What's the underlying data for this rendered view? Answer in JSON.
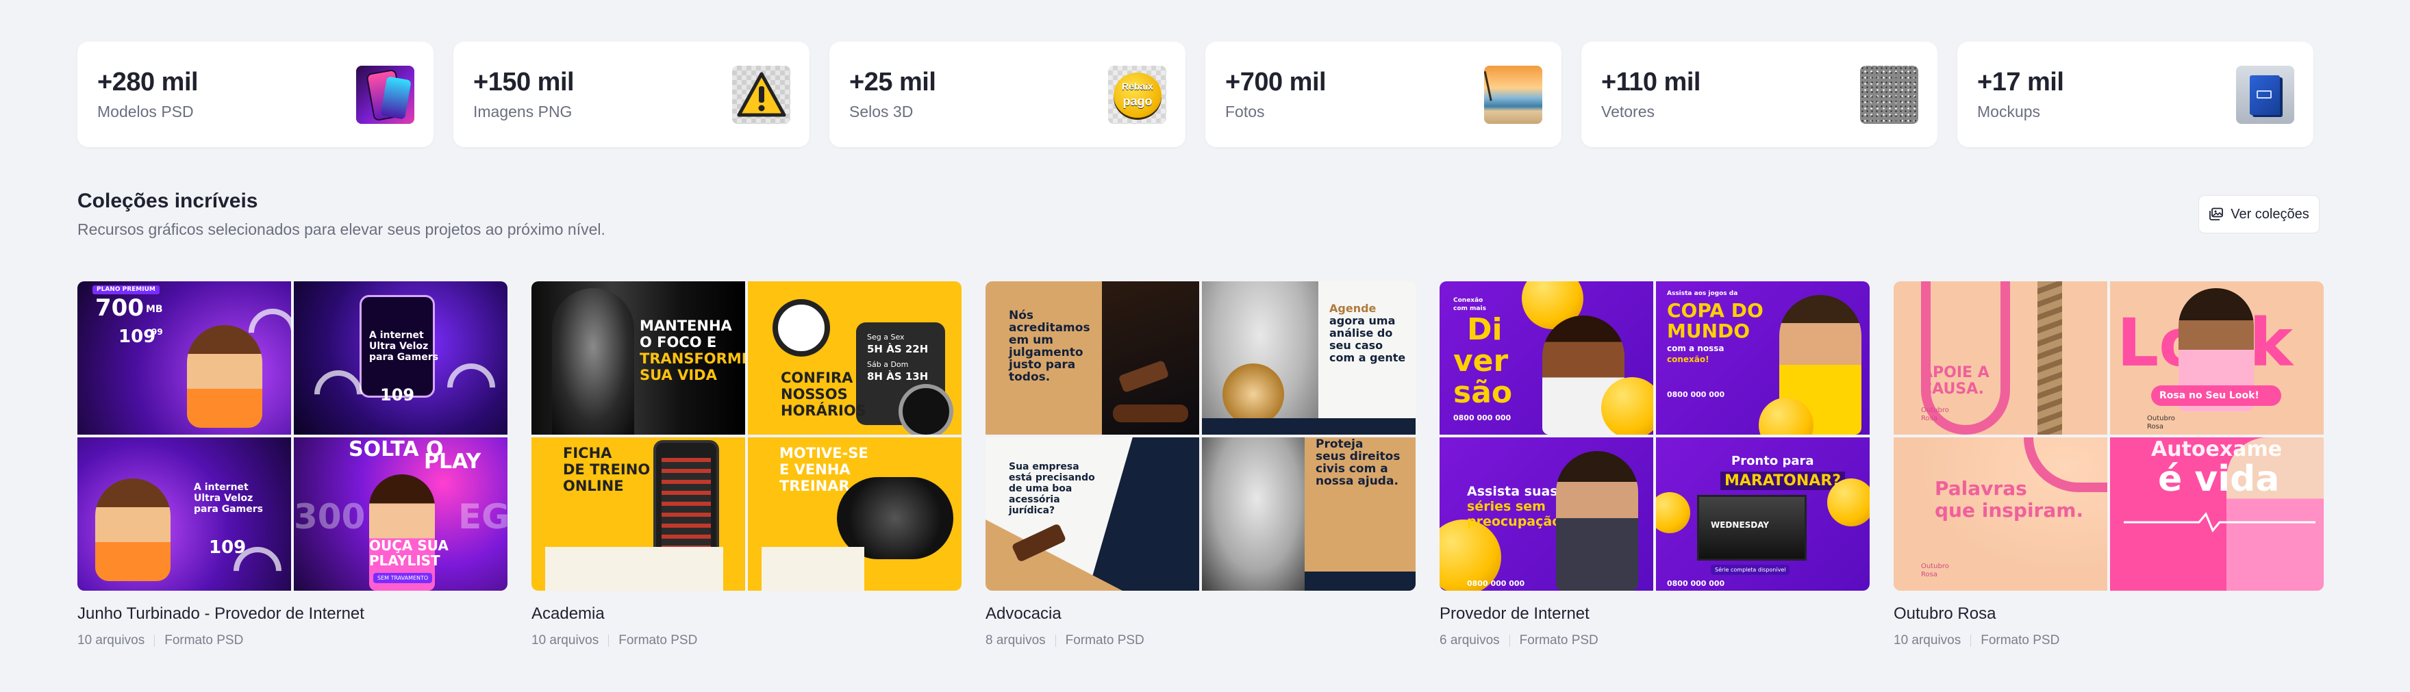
{
  "stats": [
    {
      "value": "+280 mil",
      "label": "Modelos PSD",
      "icon": "psd-template-thumbnail"
    },
    {
      "value": "+150 mil",
      "label": "Imagens PNG",
      "icon": "png-warning-sign-thumbnail"
    },
    {
      "value": "+25 mil",
      "label": "Selos 3D",
      "icon": "3d-seal-thumbnail"
    },
    {
      "value": "+700 mil",
      "label": "Fotos",
      "icon": "beach-photo-thumbnail"
    },
    {
      "value": "+110 mil",
      "label": "Vetores",
      "icon": "vector-texture-thumbnail"
    },
    {
      "value": "+17 mil",
      "label": "Mockups",
      "icon": "box-mockup-thumbnail"
    }
  ],
  "thumbs": {
    "seal_text_1": "Rebaix",
    "seal_text_2": "pago"
  },
  "section": {
    "title": "Coleções incríveis",
    "subtitle": "Recursos gráficos selecionados para elevar seus projetos ao próximo nível.",
    "button_label": "Ver coleções"
  },
  "collections": [
    {
      "name": "Junho Turbinado - Provedor de Internet",
      "files": "10 arquivos",
      "format": "Formato PSD",
      "tiles": {
        "t1_tag": "PLANO PREMIUM",
        "t1_speed": "700",
        "t1_unit": "MB",
        "t1_price": "109",
        "t1_cents": "99",
        "t2_l1": "A internet",
        "t2_l2": "Ultra Veloz",
        "t2_l3": "para Gamers",
        "t2_price": "109",
        "t3_l1": "A internet",
        "t3_l2": "Ultra Veloz",
        "t3_l3": "para Gamers",
        "t3_price": "109",
        "t4_l1": "SOLTA O",
        "t4_l2": "PLAY",
        "t4_l3": "OUÇA SUA",
        "t4_l4": "PLAYLIST",
        "t4_l5": "SEM TRAVAMENTO",
        "t4_big_left": "300",
        "t4_big_right": "EGA"
      }
    },
    {
      "name": "Academia",
      "files": "10 arquivos",
      "format": "Formato PSD",
      "tiles": {
        "t1_l1": "MANTENHA",
        "t1_l2": "O FOCO E",
        "t1_l3": "TRANSFORME",
        "t1_l4": "SUA VIDA",
        "t2_l1": "CONFIRA",
        "t2_l2": "NOSSOS",
        "t2_l3": "HORÁRIOS",
        "t2_d1": "Seg a Sex",
        "t2_h1": "5H ÀS 22H",
        "t2_d2": "Sáb a Dom",
        "t2_h2": "8H ÀS 13H",
        "t3_l1": "FICHA",
        "t3_l2": "DE TREINO",
        "t3_l3": "ONLINE",
        "t4_l1": "MOTIVE-SE",
        "t4_l2": "E VENHA",
        "t4_l3": "TREINAR"
      }
    },
    {
      "name": "Advocacia",
      "files": "8 arquivos",
      "format": "Formato PSD",
      "tiles": {
        "t1_l1": "Nós",
        "t1_l2": "acreditamos",
        "t1_l3": "em um",
        "t1_l4": "julgamento",
        "t1_l5": "justo para",
        "t1_l6": "todos.",
        "t2_l1": "Agende",
        "t2_l2": "agora uma",
        "t2_l3": "análise do",
        "t2_l4": "seu caso",
        "t2_l5": "com a gente",
        "t3_l1": "Sua empresa",
        "t3_l2": "está precisando",
        "t3_l3": "de uma boa",
        "t3_l4": "acessória",
        "t3_l5": "jurídica?",
        "t4_l1": "Proteja",
        "t4_l2": "seus direitos",
        "t4_l3": "civis com a",
        "t4_l4": "nossa ajuda."
      }
    },
    {
      "name": "Provedor de Internet",
      "files": "6 arquivos",
      "format": "Formato PSD",
      "tiles": {
        "t1_l1": "Conexão",
        "t1_l2": "com mais",
        "t1_l3": "Di",
        "t1_l4": "ver",
        "t1_l5": "são",
        "t1_phone": "0800 000 000",
        "t2_l1": "Assista aos jogos da",
        "t2_l2": "COPA DO",
        "t2_l3": "MUNDO",
        "t2_l4": "com a nossa",
        "t2_l5": "conexão!",
        "t2_phone": "0800 000 000",
        "t3_l1": "Assista suas",
        "t3_l2": "séries sem",
        "t3_l3": "preocupação.",
        "t3_phone": "0800 000 000",
        "t4_l1": "Pronto para",
        "t4_l2": "MARATONAR?",
        "t4_show": "WEDNESDAY",
        "t4_cta": "Série completa disponível",
        "t4_phone": "0800 000 000"
      }
    },
    {
      "name": "Outubro Rosa",
      "files": "10 arquivos",
      "format": "Formato PSD",
      "tiles": {
        "t1_l1": "APOIE A",
        "t1_l2": "CAUSA.",
        "t1_l3": "Outubro",
        "t1_l4": "Rosa",
        "t2_big": "Look",
        "t2_pill": "Rosa no Seu Look!",
        "t2_l1": "Outubro",
        "t2_l2": "Rosa",
        "t3_l1": "Palavras",
        "t3_l2": "que inspiram.",
        "t3_l3": "Outubro",
        "t3_l4": "Rosa",
        "t4_l1": "Autoexame",
        "t4_l2": "é vida"
      }
    }
  ]
}
